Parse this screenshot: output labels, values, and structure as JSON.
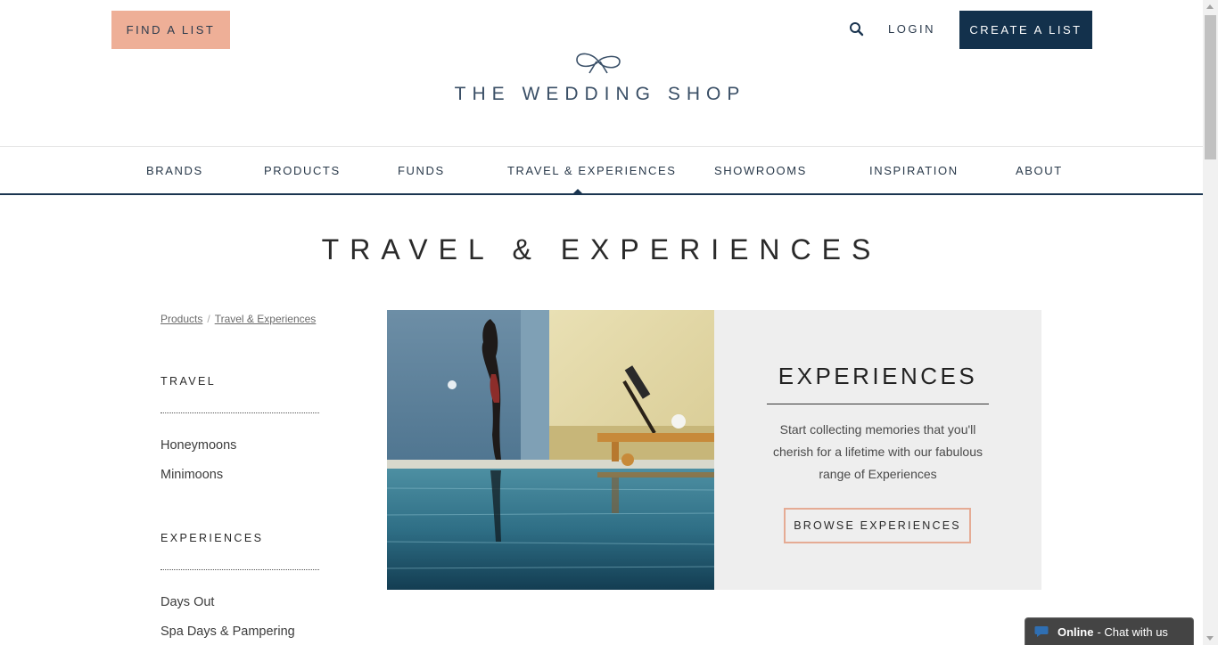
{
  "header": {
    "find_list": "FIND A LIST",
    "login": "LOGIN",
    "create_list": "CREATE A LIST",
    "logo_text": "THE WEDDING SHOP",
    "search_icon": "search-icon",
    "logo_icon": "bow-infinity-icon"
  },
  "nav": {
    "items": [
      "BRANDS",
      "PRODUCTS",
      "FUNDS",
      "TRAVEL & EXPERIENCES",
      "SHOWROOMS",
      "INSPIRATION",
      "ABOUT"
    ],
    "active": "TRAVEL & EXPERIENCES"
  },
  "page": {
    "title": "TRAVEL & EXPERIENCES"
  },
  "breadcrumb": {
    "items": [
      "Products",
      "Travel & Experiences"
    ],
    "separator": "/"
  },
  "sidebar": {
    "travel": {
      "heading": "TRAVEL",
      "links": [
        "Honeymoons",
        "Minimoons"
      ]
    },
    "experiences": {
      "heading": "EXPERIENCES",
      "links": [
        "Days Out",
        "Spa Days & Pampering"
      ]
    }
  },
  "feature": {
    "title": "EXPERIENCES",
    "description": "Start collecting memories that you'll cherish for a lifetime with our fabulous range of Experiences",
    "button": "BROWSE EXPERIENCES"
  },
  "chat": {
    "status": "Online",
    "label": "- Chat with us",
    "icon": "speech-bubble-icon"
  },
  "colors": {
    "brand_navy": "#13314c",
    "accent_peach": "#eeaf97",
    "panel_grey": "#eeeeee"
  }
}
